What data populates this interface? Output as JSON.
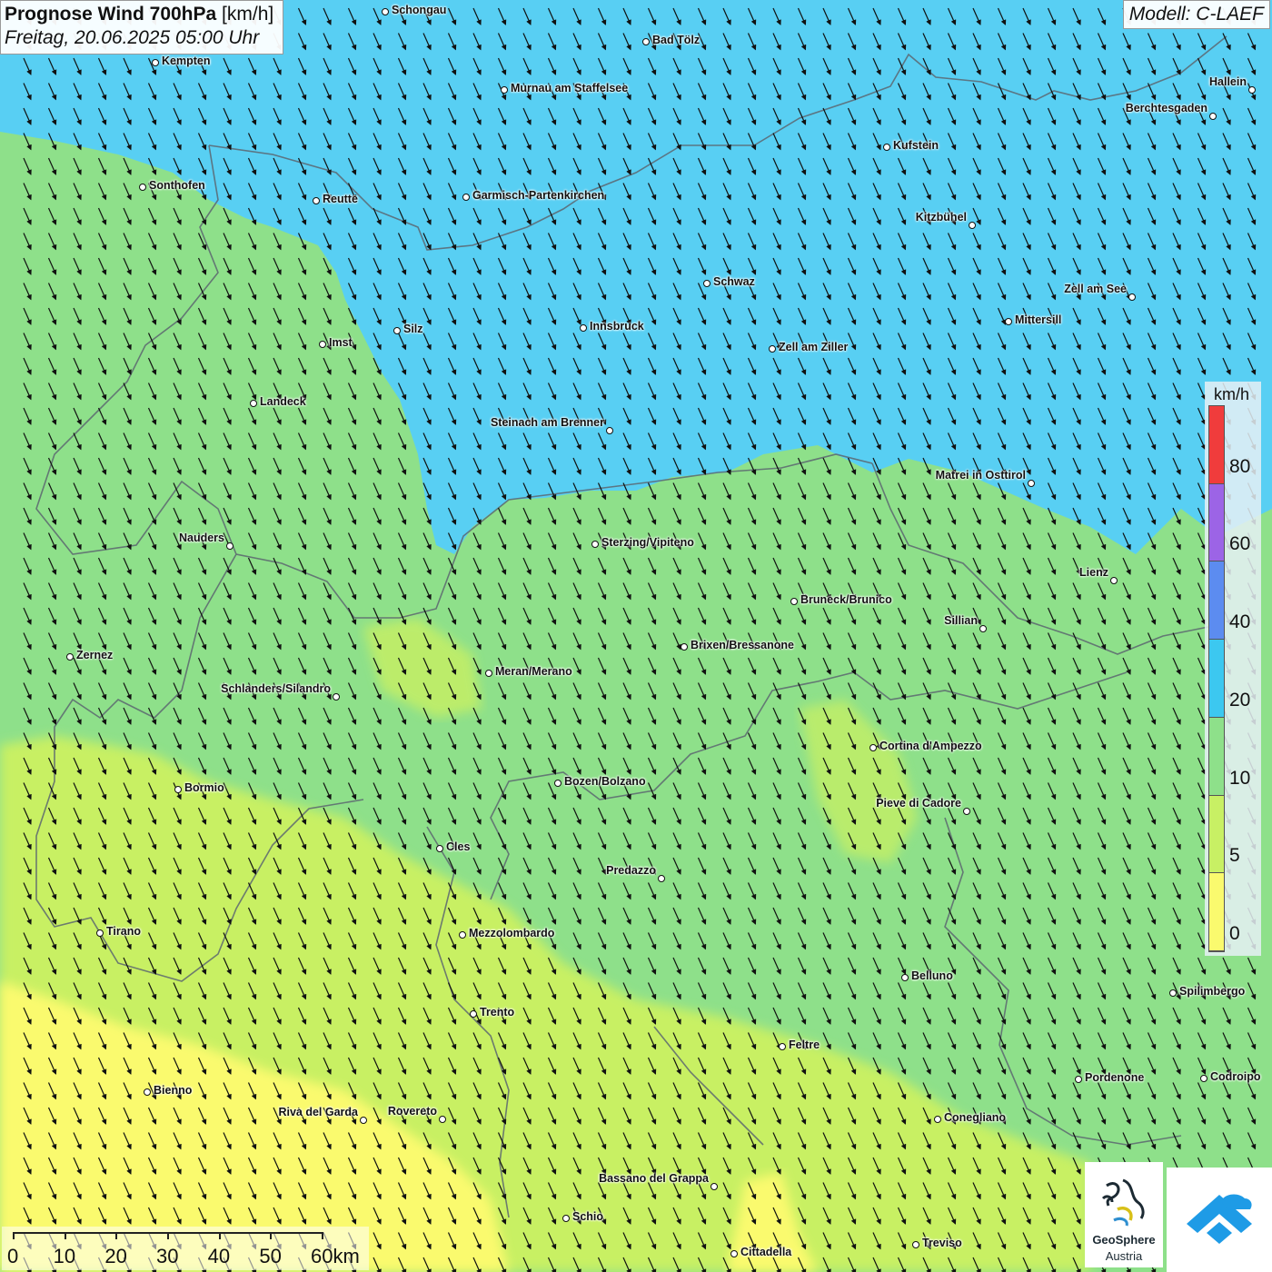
{
  "header": {
    "title": "Prognose Wind 700hPa",
    "unit": "[km/h]",
    "datetime": "Freitag, 20.06.2025 05:00 Uhr"
  },
  "model_label": "Modell: C-LAEF",
  "legend": {
    "unit": "km/h",
    "ticks": [
      "80",
      "60",
      "40",
      "20",
      "10",
      "5",
      "0"
    ],
    "colors": [
      "#f03c3c",
      "#9c64e6",
      "#5c8cf0",
      "#3cc8f0",
      "#8ee08a",
      "#c8f064",
      "#fafa6e"
    ]
  },
  "scale_bar": {
    "labels": [
      "0",
      "10",
      "20",
      "30",
      "40",
      "50",
      "60km"
    ]
  },
  "logo": {
    "line1": "GeoSphere",
    "line2": "Austria",
    "icon": "geosphere-logo-icon"
  },
  "app_icon": "geosphere-app-icon",
  "wind_field": {
    "arrow_icon": "wind-direction-arrow",
    "direction": "from north-west toward south-east"
  },
  "colors": {
    "band_30": "#58cff3",
    "band_15": "#8ee08a",
    "band_8": "#c8f064",
    "band_3": "#fafa6e",
    "border_line": "#5c6670"
  },
  "cities": [
    {
      "name": "Schongau"
    },
    {
      "name": "Bad Tölz"
    },
    {
      "name": "Kempten"
    },
    {
      "name": "Murnau am Staffelsee"
    },
    {
      "name": "Hallein"
    },
    {
      "name": "Berchtesgaden"
    },
    {
      "name": "Kufstein"
    },
    {
      "name": "Sonthofen"
    },
    {
      "name": "Reutte"
    },
    {
      "name": "Garmisch-Partenkirchen"
    },
    {
      "name": "Kitzbühel"
    },
    {
      "name": "Schwaz"
    },
    {
      "name": "Zell am See"
    },
    {
      "name": "Mittersill"
    },
    {
      "name": "Innsbruck"
    },
    {
      "name": "Silz"
    },
    {
      "name": "Imst"
    },
    {
      "name": "Zell am Ziller"
    },
    {
      "name": "Landeck"
    },
    {
      "name": "Steinach am Brenner"
    },
    {
      "name": "Matrei in Osttirol"
    },
    {
      "name": "Nauders"
    },
    {
      "name": "Sterzing/Vipiteno"
    },
    {
      "name": "Lienz"
    },
    {
      "name": "Bruneck/Brunico"
    },
    {
      "name": "Sillian"
    },
    {
      "name": "Brixen/Bressanone"
    },
    {
      "name": "Zernez"
    },
    {
      "name": "Meran/Merano"
    },
    {
      "name": "Schlanders/Silandro"
    },
    {
      "name": "Cortina d'Ampezzo"
    },
    {
      "name": "Bozen/Bolzano"
    },
    {
      "name": "Bormio"
    },
    {
      "name": "Pieve di Cadore"
    },
    {
      "name": "Cles"
    },
    {
      "name": "Predazzo"
    },
    {
      "name": "Tirano"
    },
    {
      "name": "Mezzolombardo"
    },
    {
      "name": "Belluno"
    },
    {
      "name": "Spilimbergo"
    },
    {
      "name": "Trento"
    },
    {
      "name": "Feltre"
    },
    {
      "name": "Pordenone"
    },
    {
      "name": "Codroipo"
    },
    {
      "name": "Bienno"
    },
    {
      "name": "Riva del Garda"
    },
    {
      "name": "Rovereto"
    },
    {
      "name": "Conegliano"
    },
    {
      "name": "Bassano del Grappa"
    },
    {
      "name": "Schio"
    },
    {
      "name": "Treviso"
    },
    {
      "name": "Cittadella"
    }
  ]
}
